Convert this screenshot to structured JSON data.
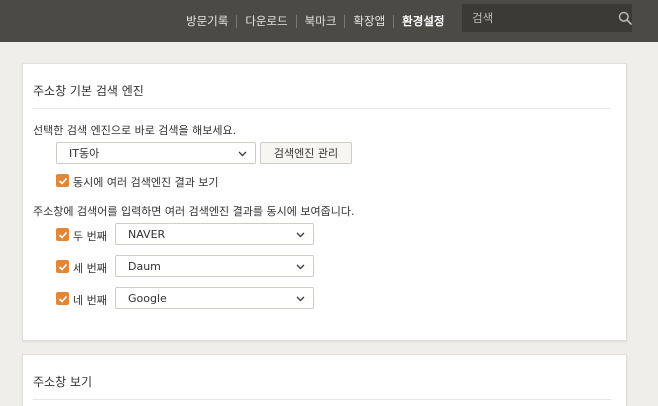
{
  "header": {
    "nav": [
      {
        "label": "방문기록",
        "active": false
      },
      {
        "label": "다운로드",
        "active": false
      },
      {
        "label": "북마크",
        "active": false
      },
      {
        "label": "확장앱",
        "active": false
      },
      {
        "label": "환경설정",
        "active": true
      }
    ],
    "search": {
      "placeholder": "검색",
      "value": ""
    },
    "colors": {
      "bar": "#4b4a45",
      "search_bg": "#3b3a36"
    }
  },
  "search_engine_panel": {
    "title": "주소창 기본 검색 엔진",
    "instruction": "선택한 검색 엔진으로 바로 검색을 해보세요.",
    "default_engine": "IT동아",
    "manage_button": "검색엔진 관리",
    "multi_result_checkbox": {
      "label": "동시에 여러 검색엔진 결과 보기",
      "checked": true
    },
    "multi_description": "주소창에 검색어를 입력하면 여러 검색엔진 결과를 동시에 보여줍니다.",
    "extra_engines": [
      {
        "label": "두 번째",
        "checked": true,
        "engine": "NAVER"
      },
      {
        "label": "세 번째",
        "checked": true,
        "engine": "Daum"
      },
      {
        "label": "네 번째",
        "checked": true,
        "engine": "Google"
      }
    ],
    "accent_color": "#e0873a"
  },
  "address_bar_panel": {
    "title": "주소창 보기"
  }
}
